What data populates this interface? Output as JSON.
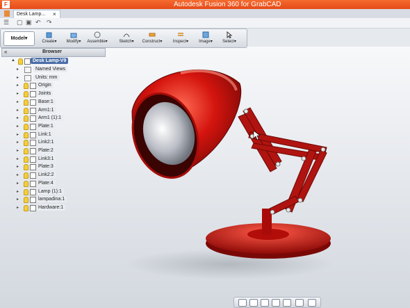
{
  "window": {
    "title": "Autodesk Fusion 360 for GrabCAD"
  },
  "tab": {
    "label": "Desk Lamp...",
    "close": "×"
  },
  "toolbar": {
    "workspace": "Model",
    "tools": [
      {
        "label": "Create",
        "icon": "cube-icon"
      },
      {
        "label": "Modify",
        "icon": "modify-icon"
      },
      {
        "label": "Assemble",
        "icon": "assemble-icon"
      },
      {
        "label": "Sketch",
        "icon": "sketch-icon"
      },
      {
        "label": "Construct",
        "icon": "construct-icon"
      },
      {
        "label": "Inspect",
        "icon": "inspect-icon"
      },
      {
        "label": "Image",
        "icon": "image-icon"
      },
      {
        "label": "Select",
        "icon": "select-icon"
      }
    ]
  },
  "browser": {
    "title": "Browser",
    "root": "Desk Lamp-V9",
    "items": [
      {
        "label": "Named Views"
      },
      {
        "label": "Units: mm"
      },
      {
        "label": "Origin"
      },
      {
        "label": "Joints"
      },
      {
        "label": "Base:1"
      },
      {
        "label": "Arm1:1"
      },
      {
        "label": "Arm1 (1):1"
      },
      {
        "label": "Plate:1"
      },
      {
        "label": "Link:1"
      },
      {
        "label": "Link2:1"
      },
      {
        "label": "Plate:2"
      },
      {
        "label": "Link3:1"
      },
      {
        "label": "Plate:3"
      },
      {
        "label": "Link2:2"
      },
      {
        "label": "Plate:4"
      },
      {
        "label": "Lamp (1):1"
      },
      {
        "label": "lampadina:1"
      },
      {
        "label": "Hardware:1"
      }
    ]
  },
  "colors": {
    "title_bar": "#e64a19",
    "lamp_red": "#c8100c",
    "selection": "#4b6ea8"
  }
}
